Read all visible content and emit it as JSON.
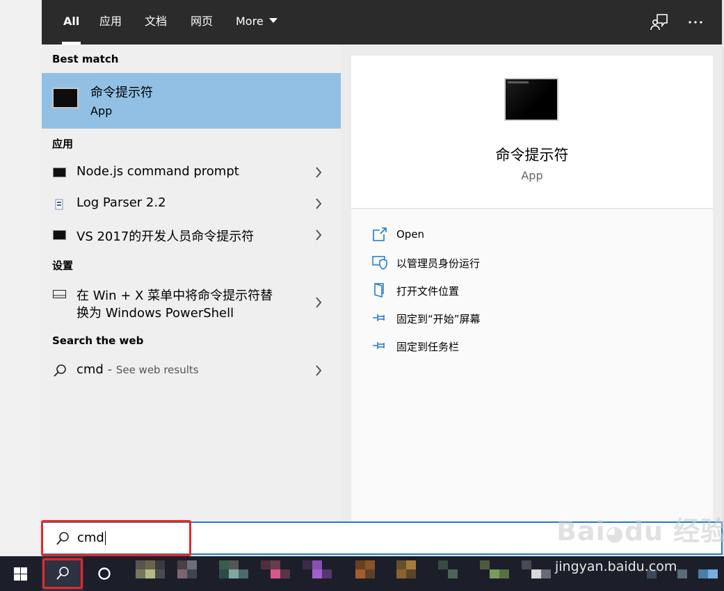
{
  "header": {
    "tabs": [
      {
        "label": "All"
      },
      {
        "label": "应用"
      },
      {
        "label": "文档"
      },
      {
        "label": "网页"
      },
      {
        "label": "More"
      }
    ]
  },
  "results": {
    "best_match_header": "Best match",
    "best_match": {
      "name": "命令提示符",
      "kind": "App"
    },
    "apps_header": "应用",
    "apps": [
      {
        "name": "Node.js command prompt"
      },
      {
        "name": "Log Parser 2.2"
      },
      {
        "name": "VS 2017的开发人员命令提示符"
      }
    ],
    "settings_header": "设置",
    "setting": {
      "line1": "在 Win + X 菜单中将命令提示符替",
      "line2": "换为 Windows PowerShell"
    },
    "web_header": "Search the web",
    "web": {
      "query": "cmd",
      "separator": " - ",
      "hint": "See web results"
    }
  },
  "preview": {
    "name": "命令提示符",
    "kind": "App",
    "actions": [
      {
        "label": "Open",
        "icon": "open-icon"
      },
      {
        "label": "以管理员身份运行",
        "icon": "shield-icon"
      },
      {
        "label": "打开文件位置",
        "icon": "folder-icon"
      },
      {
        "label": "固定到“开始”屏幕",
        "icon": "pin-icon"
      },
      {
        "label": "固定到任务栏",
        "icon": "pin-icon"
      }
    ]
  },
  "search": {
    "value": "cmd"
  },
  "watermark": {
    "logo": "Bai du 经验",
    "url": "jingyan.baidu.com"
  },
  "colors": {
    "accent": "#1e78d0",
    "highlight": "#92c0e5",
    "annotation": "#e52929",
    "taskbar": "#1c1f2a"
  }
}
